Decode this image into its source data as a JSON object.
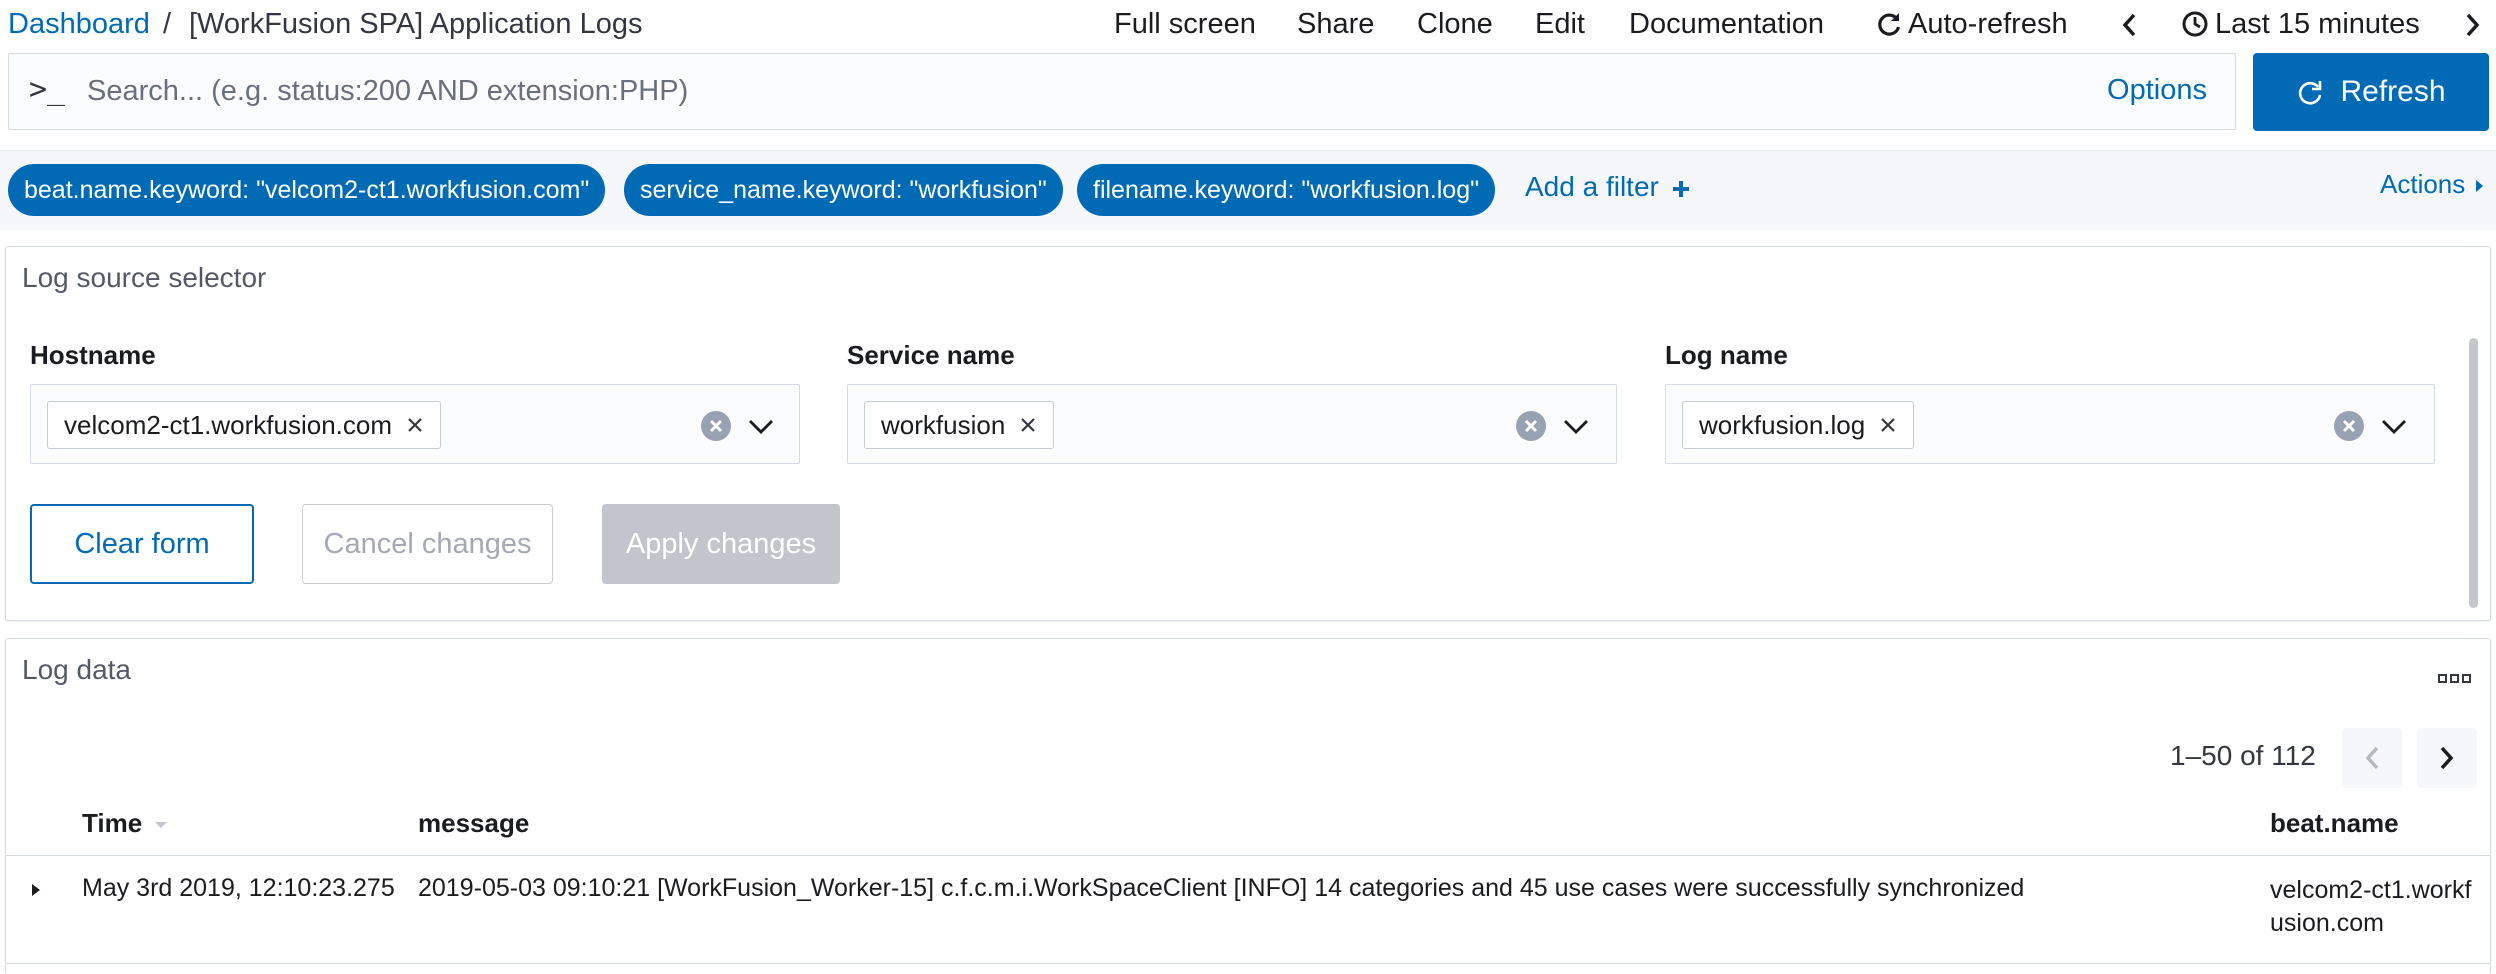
{
  "breadcrumb": {
    "root": "Dashboard",
    "separator": "/",
    "title": "[WorkFusion SPA] Application Logs"
  },
  "top_nav": {
    "full_screen": "Full screen",
    "share": "Share",
    "clone": "Clone",
    "edit": "Edit",
    "documentation": "Documentation",
    "auto_refresh": "Auto-refresh",
    "time_range": "Last 15 minutes"
  },
  "query_bar": {
    "prompt": ">_",
    "placeholder": "Search... (e.g. status:200 AND extension:PHP)",
    "value": "",
    "options_label": "Options",
    "refresh_label": "Refresh"
  },
  "filters": {
    "pills": [
      "beat.name.keyword: \"velcom2-ct1.workfusion.com\"",
      "service_name.keyword: \"workfusion\"",
      "filename.keyword: \"workfusion.log\""
    ],
    "add_filter": "Add a filter",
    "actions": "Actions"
  },
  "log_source": {
    "title": "Log source selector",
    "fields": [
      {
        "label": "Hostname",
        "value": "velcom2-ct1.workfusion.com"
      },
      {
        "label": "Service name",
        "value": "workfusion"
      },
      {
        "label": "Log name",
        "value": "workfusion.log"
      }
    ],
    "buttons": {
      "clear": "Clear form",
      "cancel": "Cancel changes",
      "apply": "Apply changes"
    }
  },
  "log_data": {
    "title": "Log data",
    "pagination": "1–50 of 112",
    "columns": [
      "Time",
      "message",
      "beat.name"
    ],
    "rows": [
      {
        "time": "May 3rd 2019, 12:10:23.275",
        "message": "2019-05-03 09:10:21 [WorkFusion_Worker-15] c.f.c.m.i.WorkSpaceClient [INFO] 14 categories and 45 use cases were successfully synchronized",
        "beat_name": "velcom2-ct1.workfusion.com"
      }
    ]
  },
  "colors": {
    "primary": "#006bb4",
    "disabled": "#c2c5cb",
    "border": "#d3dae6"
  }
}
